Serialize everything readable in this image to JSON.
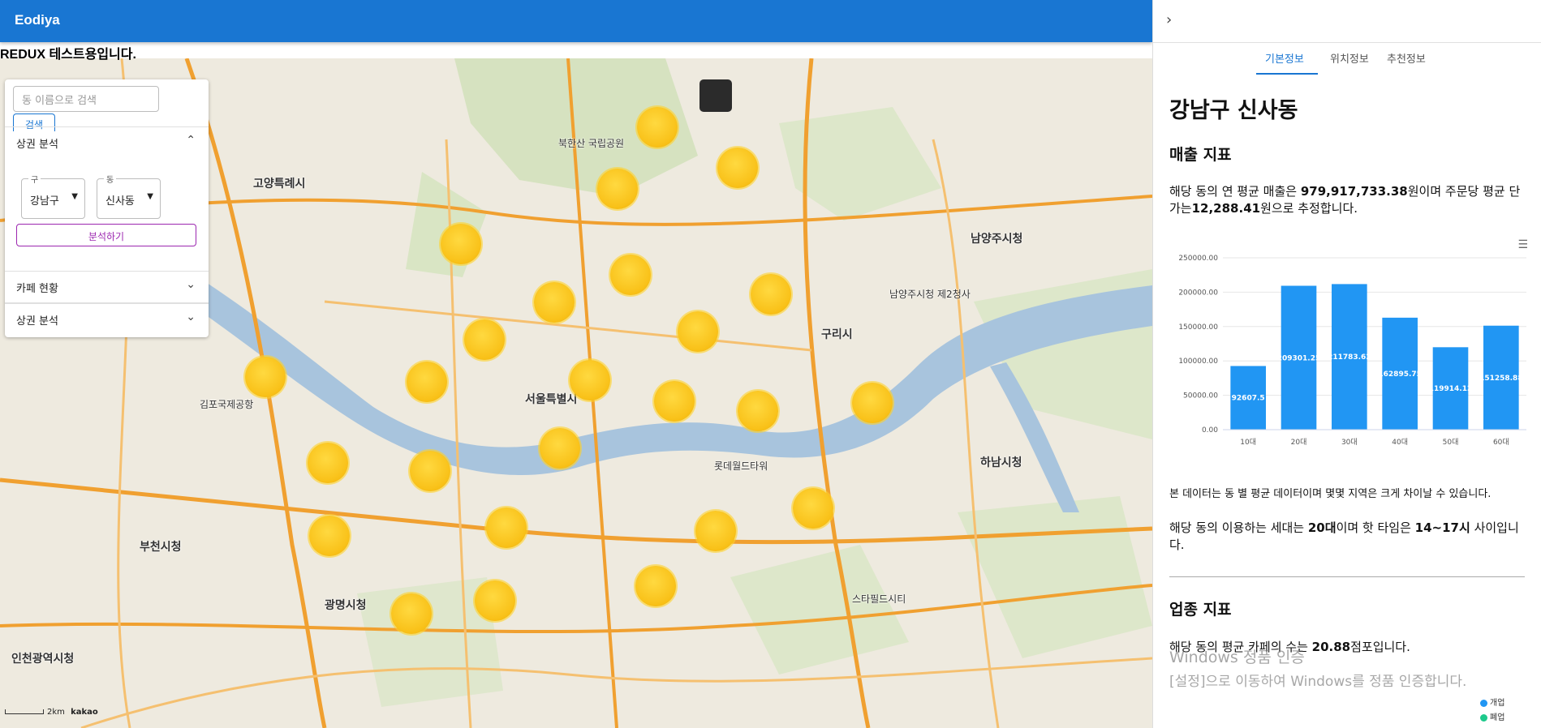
{
  "app": {
    "title": "Eodiya"
  },
  "redux_notice": "REDUX 테스트용입니다.",
  "left_panel": {
    "search_placeholder": "동 이름으로 검색",
    "search_button": "검색",
    "accordions": [
      {
        "label": "상권 분석",
        "expanded": true
      },
      {
        "label": "카페 현황",
        "expanded": false
      },
      {
        "label": "상권 분석",
        "expanded": false
      }
    ],
    "gu_select": {
      "label": "구",
      "value": "강남구"
    },
    "dong_select": {
      "label": "동",
      "value": "신사동"
    },
    "analyze_button": "분석하기"
  },
  "map": {
    "labels": [
      {
        "text": "고양특례시",
        "big": true
      },
      {
        "text": "서울특별시",
        "big": true
      },
      {
        "text": "구리시",
        "big": true
      },
      {
        "text": "남양주시청",
        "big": false
      },
      {
        "text": "하남시청",
        "big": true
      },
      {
        "text": "부천시청",
        "big": true
      },
      {
        "text": "광명시청",
        "big": true
      },
      {
        "text": "인천광역시청",
        "big": true
      },
      {
        "text": "북한산 국립공원",
        "big": false
      },
      {
        "text": "김포국제공항",
        "big": false
      },
      {
        "text": "롯데월드타워",
        "big": false
      },
      {
        "text": "스타필드시티",
        "big": false
      },
      {
        "text": "남양주시청 제2청사",
        "big": false
      }
    ],
    "scale_label": "2km",
    "provider": "kakao"
  },
  "right_panel": {
    "tabs": [
      "기본정보",
      "위치정보",
      "추천정보"
    ],
    "active_tab": 0,
    "title": "강남구 신사동",
    "sales_heading": "매출 지표",
    "sales_text_pre": "해당 동의 연 평균 매출은 ",
    "sales_value": "979,917,733.38",
    "sales_text_mid": "원이며 주문당 평균 단가는",
    "unit_price": "12,288.41",
    "sales_text_post": "원으로 추정합니다.",
    "note": "본 데이터는 동 별 평균 데이터이며 몇몇 지역은 크게 차이날 수 있습니다.",
    "generation_pre": "해당 동의 이용하는 세대는 ",
    "generation": "20대",
    "generation_mid": "이며 핫 타임은 ",
    "hot_time": "14~17시",
    "generation_post": " 사이입니다.",
    "industry_heading": "업종 지표",
    "cafe_pre": "해당 동의 평균 카페의 수는 ",
    "cafe_count": "20.88",
    "cafe_post": "점포입니다.",
    "watermark_line1": "Windows 정품 인증",
    "watermark_line2": "[설정]으로 이동하여 Windows를 정품 인증합니다.",
    "legend": [
      {
        "label": "개업",
        "color": "#2196f3"
      },
      {
        "label": "폐업",
        "color": "#1ec98b"
      }
    ]
  },
  "chart_data": {
    "type": "bar",
    "categories": [
      "10대",
      "20대",
      "30대",
      "40대",
      "50대",
      "60대"
    ],
    "values": [
      92607.5,
      209301.25,
      211783.62,
      162895.75,
      119914.12,
      151258.88
    ],
    "value_labels": [
      "92607.5",
      "209301.25",
      "211783.62",
      "162895.75",
      "119914.12",
      "151258.88"
    ],
    "ylim": [
      0,
      250000
    ],
    "yticks": [
      "0.00",
      "50000.00",
      "100000.00",
      "150000.00",
      "200000.00",
      "250000.00"
    ],
    "bar_color": "#2196f3",
    "grid": true
  }
}
